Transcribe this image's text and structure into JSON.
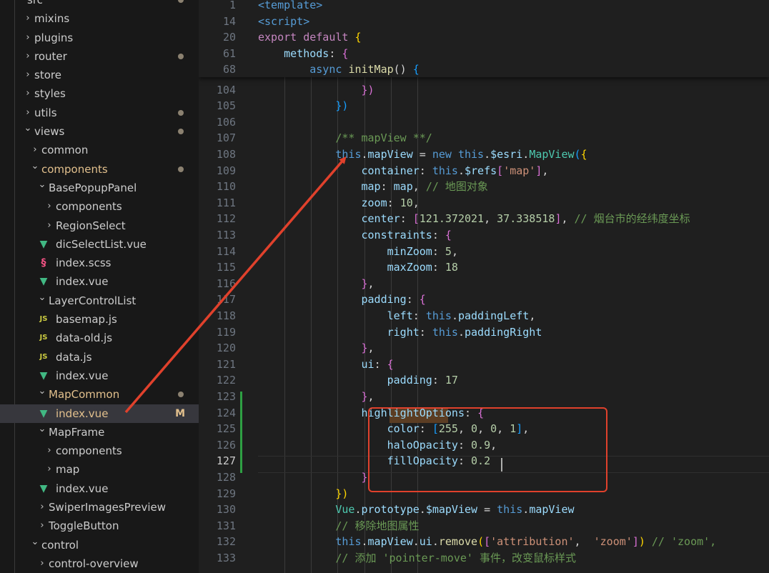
{
  "sidebar": {
    "items": [
      {
        "label": "src",
        "depth": 0,
        "type": "folder",
        "expanded": true,
        "dot": true
      },
      {
        "label": "mixins",
        "depth": 1,
        "type": "folder",
        "expanded": false
      },
      {
        "label": "plugins",
        "depth": 1,
        "type": "folder",
        "expanded": false
      },
      {
        "label": "router",
        "depth": 1,
        "type": "folder",
        "expanded": false,
        "dot": true
      },
      {
        "label": "store",
        "depth": 1,
        "type": "folder",
        "expanded": false
      },
      {
        "label": "styles",
        "depth": 1,
        "type": "folder",
        "expanded": false
      },
      {
        "label": "utils",
        "depth": 1,
        "type": "folder",
        "expanded": false,
        "dot": true
      },
      {
        "label": "views",
        "depth": 1,
        "type": "folder",
        "expanded": true,
        "dot": true
      },
      {
        "label": "common",
        "depth": 2,
        "type": "folder",
        "expanded": false
      },
      {
        "label": "components",
        "depth": 2,
        "type": "folder",
        "expanded": true,
        "dot": true,
        "modified": true
      },
      {
        "label": "BasePopupPanel",
        "depth": 3,
        "type": "folder",
        "expanded": true
      },
      {
        "label": "components",
        "depth": 4,
        "type": "folder",
        "expanded": false
      },
      {
        "label": "RegionSelect",
        "depth": 4,
        "type": "folder",
        "expanded": false
      },
      {
        "label": "dicSelectList.vue",
        "depth": 4,
        "type": "vue"
      },
      {
        "label": "index.scss",
        "depth": 4,
        "type": "scss"
      },
      {
        "label": "index.vue",
        "depth": 4,
        "type": "vue"
      },
      {
        "label": "LayerControlList",
        "depth": 3,
        "type": "folder",
        "expanded": true
      },
      {
        "label": "basemap.js",
        "depth": 4,
        "type": "js"
      },
      {
        "label": "data-old.js",
        "depth": 4,
        "type": "js"
      },
      {
        "label": "data.js",
        "depth": 4,
        "type": "js"
      },
      {
        "label": "index.vue",
        "depth": 4,
        "type": "vue"
      },
      {
        "label": "MapCommon",
        "depth": 3,
        "type": "folder",
        "expanded": true,
        "dot": true,
        "modified": true
      },
      {
        "label": "index.vue",
        "depth": 4,
        "type": "vue",
        "selected": true,
        "modified": true,
        "badge": "M"
      },
      {
        "label": "MapFrame",
        "depth": 3,
        "type": "folder",
        "expanded": true
      },
      {
        "label": "components",
        "depth": 4,
        "type": "folder",
        "expanded": false
      },
      {
        "label": "map",
        "depth": 4,
        "type": "folder",
        "expanded": false
      },
      {
        "label": "index.vue",
        "depth": 4,
        "type": "vue"
      },
      {
        "label": "SwiperImagesPreview",
        "depth": 3,
        "type": "folder",
        "expanded": false
      },
      {
        "label": "ToggleButton",
        "depth": 3,
        "type": "folder",
        "expanded": false
      },
      {
        "label": "control",
        "depth": 2,
        "type": "folder",
        "expanded": true
      },
      {
        "label": "control-overview",
        "depth": 3,
        "type": "folder",
        "expanded": false
      }
    ]
  },
  "editor": {
    "current_line": "127",
    "sticky_lines": [
      {
        "n": "1",
        "tokens": [
          [
            "<",
            "tag"
          ],
          [
            "template",
            "tag"
          ],
          [
            ">",
            "tag"
          ]
        ]
      },
      {
        "n": "14",
        "tokens": [
          [
            "<",
            "tag"
          ],
          [
            "script",
            "tag"
          ],
          [
            ">",
            "tag"
          ]
        ]
      },
      {
        "n": "20",
        "tokens": [
          [
            "export",
            "ctl"
          ],
          [
            " ",
            "pun"
          ],
          [
            "default",
            "ctl"
          ],
          [
            " ",
            "pun"
          ],
          [
            "{",
            "b1"
          ]
        ]
      },
      {
        "n": "61",
        "tokens": [
          [
            "    ",
            "pun"
          ],
          [
            "methods",
            "prop"
          ],
          [
            ": ",
            "pun"
          ],
          [
            "{",
            "b2"
          ]
        ]
      },
      {
        "n": "68",
        "tokens": [
          [
            "        ",
            "pun"
          ],
          [
            "async",
            "kw"
          ],
          [
            " ",
            "pun"
          ],
          [
            "initMap",
            "fn"
          ],
          [
            "() ",
            "pun"
          ],
          [
            "{",
            "b3"
          ]
        ]
      }
    ],
    "lines": [
      {
        "n": "104",
        "tokens": [
          [
            "                ",
            "pun"
          ],
          [
            "})",
            "b2"
          ]
        ]
      },
      {
        "n": "105",
        "tokens": [
          [
            "            ",
            "pun"
          ],
          [
            "})",
            "b3"
          ]
        ]
      },
      {
        "n": "106",
        "tokens": []
      },
      {
        "n": "107",
        "tokens": [
          [
            "            ",
            "pun"
          ],
          [
            "/** mapView **/",
            "com"
          ]
        ]
      },
      {
        "n": "108",
        "tokens": [
          [
            "            ",
            "pun"
          ],
          [
            "this",
            "kw"
          ],
          [
            ".",
            "pun"
          ],
          [
            "mapView",
            "var"
          ],
          [
            " = ",
            "pun"
          ],
          [
            "new",
            "kw"
          ],
          [
            " ",
            "pun"
          ],
          [
            "this",
            "kw"
          ],
          [
            ".",
            "pun"
          ],
          [
            "$esri",
            "var"
          ],
          [
            ".",
            "pun"
          ],
          [
            "MapView",
            "cls"
          ],
          [
            "(",
            "b3"
          ],
          [
            "{",
            "b1"
          ]
        ]
      },
      {
        "n": "109",
        "tokens": [
          [
            "                ",
            "pun"
          ],
          [
            "container",
            "prop"
          ],
          [
            ": ",
            "pun"
          ],
          [
            "this",
            "kw"
          ],
          [
            ".",
            "pun"
          ],
          [
            "$refs",
            "var"
          ],
          [
            "[",
            "b2"
          ],
          [
            "'map'",
            "str"
          ],
          [
            "]",
            "b2"
          ],
          [
            ",",
            "pun"
          ]
        ]
      },
      {
        "n": "110",
        "tokens": [
          [
            "                ",
            "pun"
          ],
          [
            "map",
            "prop"
          ],
          [
            ": ",
            "pun"
          ],
          [
            "map",
            "var"
          ],
          [
            ", ",
            "pun"
          ],
          [
            "// 地图对象",
            "com"
          ]
        ]
      },
      {
        "n": "111",
        "tokens": [
          [
            "                ",
            "pun"
          ],
          [
            "zoom",
            "prop"
          ],
          [
            ": ",
            "pun"
          ],
          [
            "10",
            "num"
          ],
          [
            ",",
            "pun"
          ]
        ]
      },
      {
        "n": "112",
        "tokens": [
          [
            "                ",
            "pun"
          ],
          [
            "center",
            "prop"
          ],
          [
            ": ",
            "pun"
          ],
          [
            "[",
            "b2"
          ],
          [
            "121.372021",
            "num"
          ],
          [
            ", ",
            "pun"
          ],
          [
            "37.338518",
            "num"
          ],
          [
            "]",
            "b2"
          ],
          [
            ", ",
            "pun"
          ],
          [
            "// 烟台市的经纬度坐标",
            "com"
          ]
        ]
      },
      {
        "n": "113",
        "tokens": [
          [
            "                ",
            "pun"
          ],
          [
            "constraints",
            "prop"
          ],
          [
            ": ",
            "pun"
          ],
          [
            "{",
            "b2"
          ]
        ]
      },
      {
        "n": "114",
        "tokens": [
          [
            "                    ",
            "pun"
          ],
          [
            "minZoom",
            "prop"
          ],
          [
            ": ",
            "pun"
          ],
          [
            "5",
            "num"
          ],
          [
            ",",
            "pun"
          ]
        ]
      },
      {
        "n": "115",
        "tokens": [
          [
            "                    ",
            "pun"
          ],
          [
            "maxZoom",
            "prop"
          ],
          [
            ": ",
            "pun"
          ],
          [
            "18",
            "num"
          ]
        ]
      },
      {
        "n": "116",
        "tokens": [
          [
            "                ",
            "pun"
          ],
          [
            "}",
            "b2"
          ],
          [
            ",",
            "pun"
          ]
        ]
      },
      {
        "n": "117",
        "tokens": [
          [
            "                ",
            "pun"
          ],
          [
            "padding",
            "prop"
          ],
          [
            ": ",
            "pun"
          ],
          [
            "{",
            "b2"
          ]
        ]
      },
      {
        "n": "118",
        "tokens": [
          [
            "                    ",
            "pun"
          ],
          [
            "left",
            "prop"
          ],
          [
            ": ",
            "pun"
          ],
          [
            "this",
            "kw"
          ],
          [
            ".",
            "pun"
          ],
          [
            "paddingLeft",
            "var"
          ],
          [
            ",",
            "pun"
          ]
        ]
      },
      {
        "n": "119",
        "tokens": [
          [
            "                    ",
            "pun"
          ],
          [
            "right",
            "prop"
          ],
          [
            ": ",
            "pun"
          ],
          [
            "this",
            "kw"
          ],
          [
            ".",
            "pun"
          ],
          [
            "paddingRight",
            "var"
          ]
        ]
      },
      {
        "n": "120",
        "tokens": [
          [
            "                ",
            "pun"
          ],
          [
            "}",
            "b2"
          ],
          [
            ",",
            "pun"
          ]
        ]
      },
      {
        "n": "121",
        "tokens": [
          [
            "                ",
            "pun"
          ],
          [
            "ui",
            "prop"
          ],
          [
            ": ",
            "pun"
          ],
          [
            "{",
            "b2"
          ]
        ]
      },
      {
        "n": "122",
        "tokens": [
          [
            "                    ",
            "pun"
          ],
          [
            "padding",
            "prop"
          ],
          [
            ": ",
            "pun"
          ],
          [
            "17",
            "num"
          ]
        ]
      },
      {
        "n": "123",
        "tokens": [
          [
            "                ",
            "pun"
          ],
          [
            "}",
            "b2"
          ],
          [
            ",",
            "pun"
          ]
        ]
      },
      {
        "n": "124",
        "tokens": [
          [
            "                ",
            "pun"
          ],
          [
            "highlightOptions",
            "prop"
          ],
          [
            ": ",
            "pun"
          ],
          [
            "{",
            "b2"
          ]
        ]
      },
      {
        "n": "125",
        "tokens": [
          [
            "                    ",
            "pun"
          ],
          [
            "color",
            "prop"
          ],
          [
            ": ",
            "pun"
          ],
          [
            "[",
            "b3"
          ],
          [
            "255",
            "num"
          ],
          [
            ", ",
            "pun"
          ],
          [
            "0",
            "num"
          ],
          [
            ", ",
            "pun"
          ],
          [
            "0",
            "num"
          ],
          [
            ", ",
            "pun"
          ],
          [
            "1",
            "num"
          ],
          [
            "]",
            "b3"
          ],
          [
            ",",
            "pun"
          ]
        ]
      },
      {
        "n": "126",
        "tokens": [
          [
            "                    ",
            "pun"
          ],
          [
            "haloOpacity",
            "prop"
          ],
          [
            ": ",
            "pun"
          ],
          [
            "0.9",
            "num"
          ],
          [
            ",",
            "pun"
          ]
        ]
      },
      {
        "n": "127",
        "tokens": [
          [
            "                    ",
            "pun"
          ],
          [
            "fillOpacity",
            "prop"
          ],
          [
            ": ",
            "pun"
          ],
          [
            "0.2",
            "num"
          ]
        ]
      },
      {
        "n": "128",
        "tokens": [
          [
            "                ",
            "pun"
          ],
          [
            "}",
            "b2"
          ]
        ]
      },
      {
        "n": "129",
        "tokens": [
          [
            "            ",
            "pun"
          ],
          [
            "})",
            "b1"
          ]
        ]
      },
      {
        "n": "130",
        "tokens": [
          [
            "            ",
            "pun"
          ],
          [
            "Vue",
            "cls"
          ],
          [
            ".",
            "pun"
          ],
          [
            "prototype",
            "var"
          ],
          [
            ".",
            "pun"
          ],
          [
            "$mapView",
            "var"
          ],
          [
            " = ",
            "pun"
          ],
          [
            "this",
            "kw"
          ],
          [
            ".",
            "pun"
          ],
          [
            "mapView",
            "var"
          ]
        ]
      },
      {
        "n": "131",
        "tokens": [
          [
            "            ",
            "pun"
          ],
          [
            "// 移除地图属性",
            "com"
          ]
        ]
      },
      {
        "n": "132",
        "tokens": [
          [
            "            ",
            "pun"
          ],
          [
            "this",
            "kw"
          ],
          [
            ".",
            "pun"
          ],
          [
            "mapView",
            "var"
          ],
          [
            ".",
            "pun"
          ],
          [
            "ui",
            "var"
          ],
          [
            ".",
            "pun"
          ],
          [
            "remove",
            "fn"
          ],
          [
            "(",
            "b1"
          ],
          [
            "[",
            "b2"
          ],
          [
            "'attribution'",
            "str"
          ],
          [
            ",  ",
            "pun"
          ],
          [
            "'zoom'",
            "str"
          ],
          [
            "]",
            "b2"
          ],
          [
            ")",
            "b1"
          ],
          [
            " ",
            "pun"
          ],
          [
            "// 'zoom',",
            "com"
          ]
        ]
      },
      {
        "n": "133",
        "tokens": [
          [
            "            ",
            "pun"
          ],
          [
            "// 添加 'pointer-move' 事件，改变鼠标样式",
            "com"
          ]
        ]
      }
    ]
  },
  "colors": {
    "accent": "#e0412c",
    "modified": "#e2c08d",
    "git_added": "#2ea043"
  }
}
